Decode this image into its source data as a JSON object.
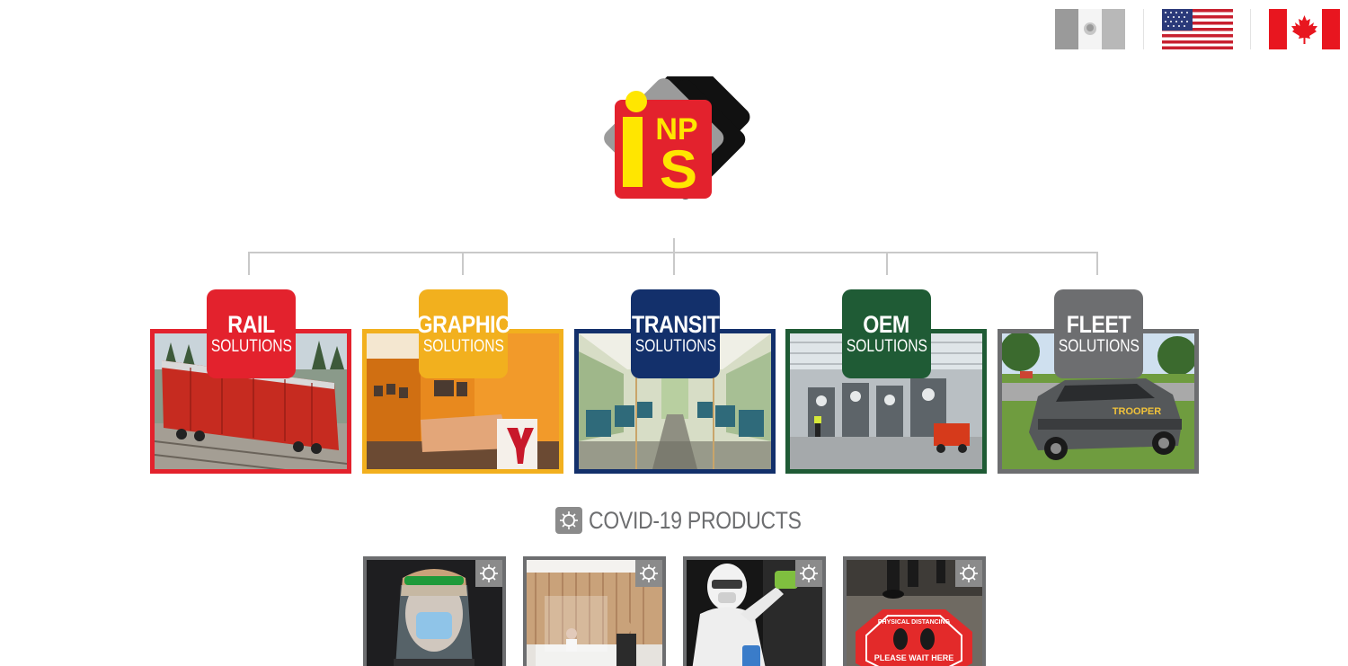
{
  "flags": [
    {
      "id": "mx",
      "icon": "mexico-flag-icon"
    },
    {
      "id": "us",
      "icon": "usa-flag-icon"
    },
    {
      "id": "ca",
      "icon": "canada-flag-icon"
    }
  ],
  "logo": {
    "icon": "inps-logo",
    "letters_top": "NP",
    "letters_bottom": "S",
    "colors": {
      "red": "#e3222d",
      "yellow": "#ffe600",
      "gray": "#9b9b9b",
      "black": "#111111"
    }
  },
  "divisions": [
    {
      "title": "RAIL",
      "subtitle": "SOLUTIONS",
      "color": "#e3222d"
    },
    {
      "title": "GRAPHIC",
      "subtitle": "SOLUTIONS",
      "color": "#f2b01e"
    },
    {
      "title": "TRANSIT",
      "subtitle": "SOLUTIONS",
      "color": "#13306b"
    },
    {
      "title": "OEM",
      "subtitle": "SOLUTIONS",
      "color": "#1f5b35"
    },
    {
      "title": "FLEET",
      "subtitle": "SOLUTIONS",
      "color": "#6d6e70"
    }
  ],
  "covid": {
    "heading": "COVID-19 PRODUCTS",
    "icon": "virus-icon",
    "products": [
      {
        "icon": "face-shield-photo"
      },
      {
        "icon": "reception-barrier-photo"
      },
      {
        "icon": "sanitizing-photo"
      },
      {
        "icon": "floor-decal-photo",
        "decal_top": "PHYSICAL DISTANCING",
        "decal_bottom": "PLEASE WAIT HERE"
      }
    ]
  },
  "fleet_photo_text": "TROOPER"
}
